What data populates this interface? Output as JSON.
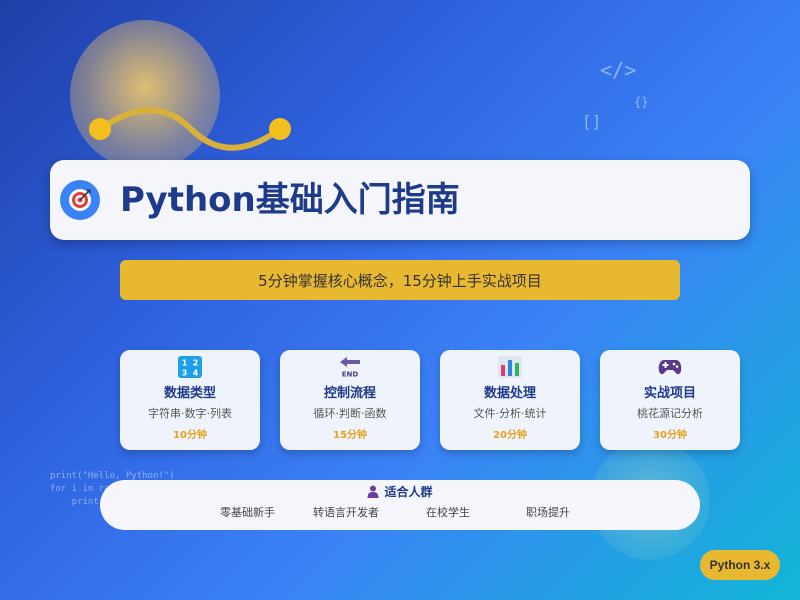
{
  "title": "Python基础入门指南",
  "subtitle": "5分钟掌握核心概念，15分钟上手实战项目",
  "cards": [
    {
      "icon": "number-keypad-icon",
      "title": "数据类型",
      "desc": "字符串·数字·列表",
      "time": "10分钟"
    },
    {
      "icon": "end-arrow-icon",
      "title": "控制流程",
      "desc": "循环·判断·函数",
      "time": "15分钟"
    },
    {
      "icon": "bar-chart-icon",
      "title": "数据处理",
      "desc": "文件·分析·统计",
      "time": "20分钟"
    },
    {
      "icon": "gamepad-icon",
      "title": "实战项目",
      "desc": "桃花源记分析",
      "time": "30分钟"
    }
  ],
  "audience": {
    "heading": "适合人群",
    "items": [
      "零基础新手",
      "转语言开发者",
      "在校学生",
      "职场提升"
    ]
  },
  "badge": "Python 3.x",
  "code_snippet": "print(\"Hello, Python!\")\nfor i in range(10):\n    print(i)",
  "decor_symbols": [
    "</>",
    "{}",
    "[]"
  ],
  "colors": {
    "accent": "#e9b831",
    "title": "#1e3a8a",
    "time": "#e8a020"
  }
}
